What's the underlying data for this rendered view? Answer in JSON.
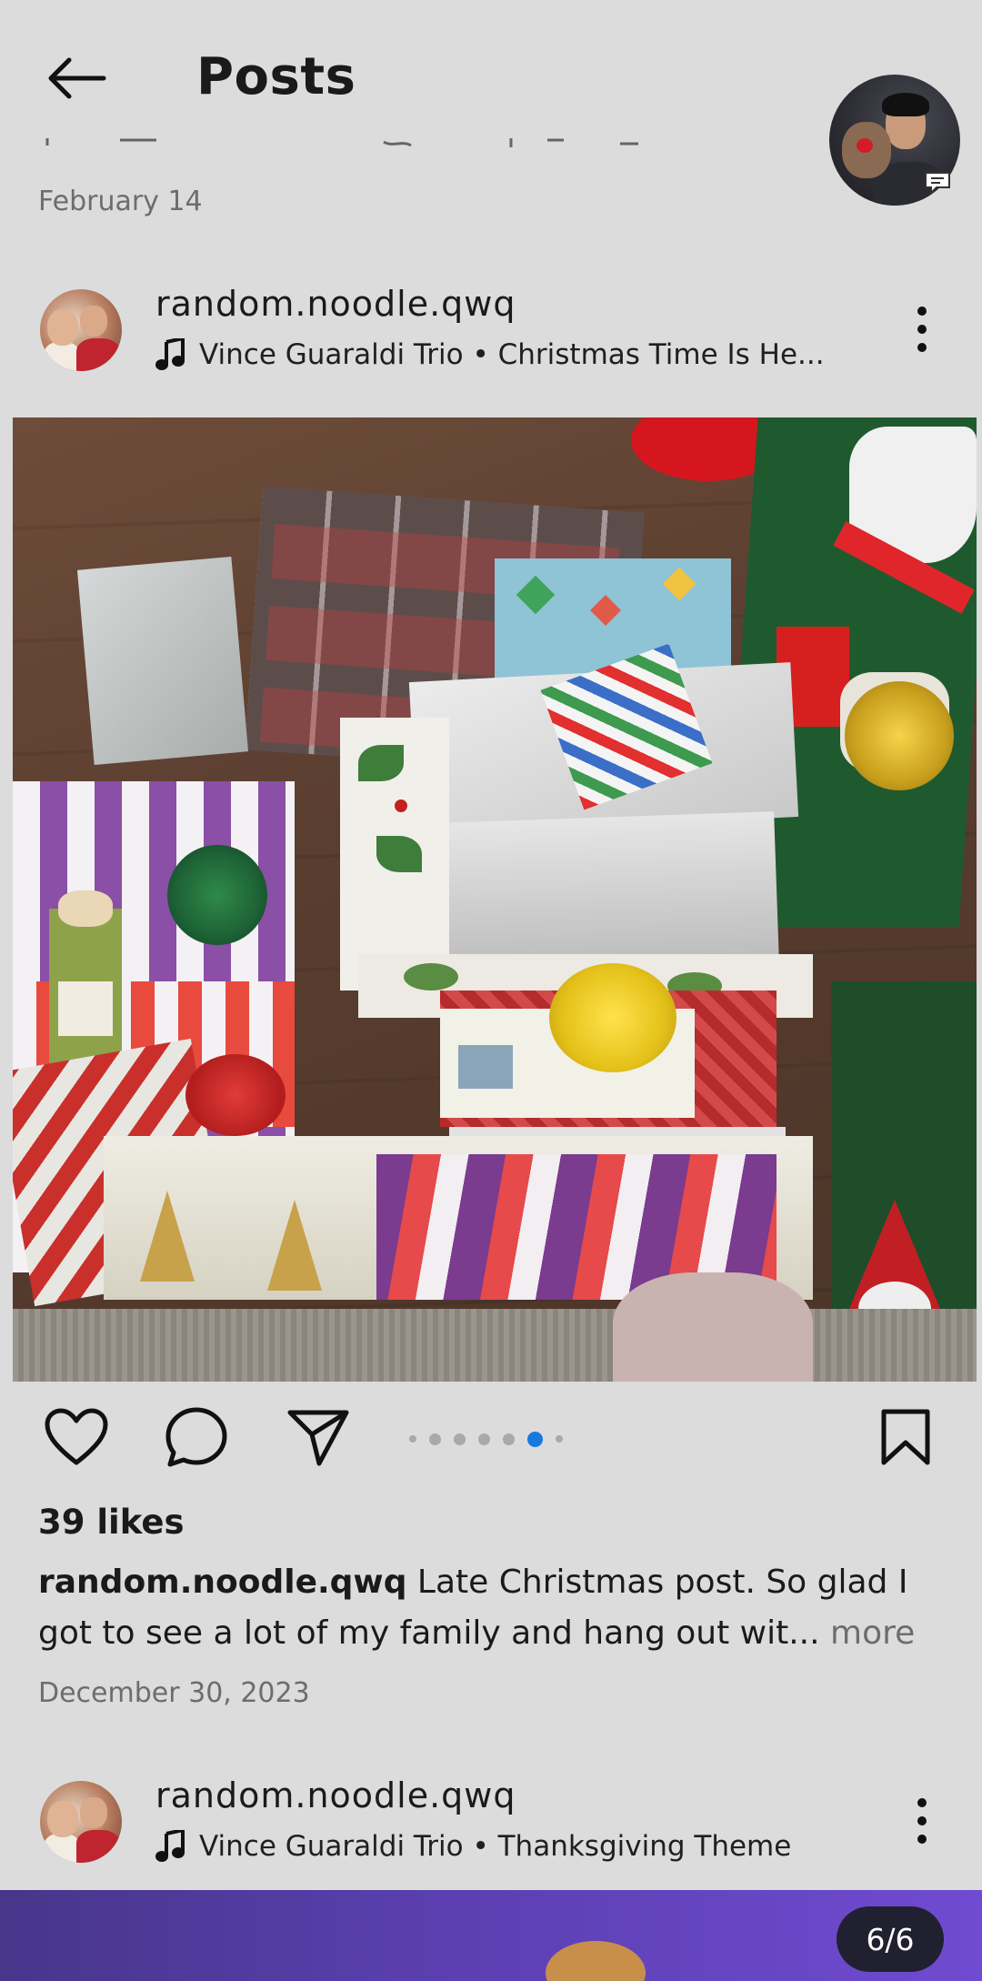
{
  "header": {
    "title": "Posts",
    "back_icon": "arrow-left-icon",
    "chat_icon": "chat-bubble-icon"
  },
  "previous_post": {
    "date": "February 14"
  },
  "post": {
    "username": "random.noodle.qwq",
    "music": "Vince Guaraldi Trio • Christmas Time Is He...",
    "likes": "39 likes",
    "caption_user": "random.noodle.qwq",
    "caption_text": " Late Christmas post. So glad I got to see a lot of my family and hang out wit...",
    "caption_more": " more",
    "date": "December 30, 2023",
    "carousel": {
      "total": 6,
      "current": 5
    }
  },
  "next_post": {
    "username": "random.noodle.qwq",
    "music": "Vince Guaraldi Trio • Thanksgiving Theme",
    "counter": "6/6"
  },
  "colors": {
    "background": "#dcdcdc",
    "accent": "#1778e0",
    "muted_text": "#6d6d6d"
  }
}
